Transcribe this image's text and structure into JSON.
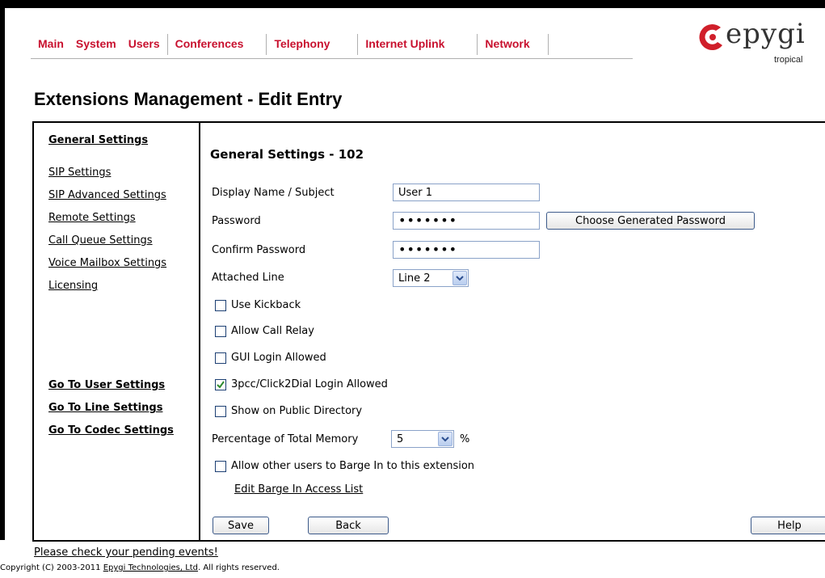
{
  "nav": {
    "items": [
      "Main",
      "System",
      "Users",
      "Conferences",
      "Telephony",
      "Internet Uplink",
      "Network"
    ]
  },
  "logo": {
    "word": "epygi",
    "tag": "tropical"
  },
  "page_title": "Extensions Management - Edit Entry",
  "sidebar": {
    "items": [
      "General Settings",
      "SIP Settings",
      "SIP Advanced Settings",
      "Remote Settings",
      "Call Queue Settings",
      "Voice Mailbox Settings",
      "Licensing"
    ],
    "goto": [
      "Go To User Settings",
      "Go To Line Settings",
      "Go To Codec Settings"
    ]
  },
  "form": {
    "section_title": "General Settings - 102",
    "display_name_label": "Display Name / Subject",
    "display_name_value": "User 1",
    "password_label": "Password",
    "password_value": "•••••••",
    "generate_button": "Choose Generated Password",
    "confirm_label": "Confirm Password",
    "confirm_value": "•••••••",
    "attached_line_label": "Attached Line",
    "attached_line_value": "Line 2",
    "checkboxes": [
      {
        "label": "Use Kickback",
        "checked": false
      },
      {
        "label": "Allow Call Relay",
        "checked": false
      },
      {
        "label": "GUI Login Allowed",
        "checked": false
      },
      {
        "label": "3pcc/Click2Dial Login Allowed",
        "checked": true
      },
      {
        "label": "Show on Public Directory",
        "checked": false
      }
    ],
    "memory_label": "Percentage of Total Memory",
    "memory_value": "5",
    "memory_unit": "%",
    "barge_label": "Allow other users to Barge In to this extension",
    "barge_checked": false,
    "barge_link": "Edit Barge In Access List",
    "save_button": "Save",
    "back_button": "Back",
    "help_button": "Help"
  },
  "footer": {
    "pending": "Please check your pending events!",
    "copyright_prefix": "Copyright (C) 2003-2011 ",
    "copyright_link": "Epygi Technologies, Ltd",
    "copyright_suffix": ". All rights reserved."
  },
  "colors": {
    "nav": "#c8102e",
    "logo_red": "#d01f2a",
    "check": "#2e8b2e"
  }
}
